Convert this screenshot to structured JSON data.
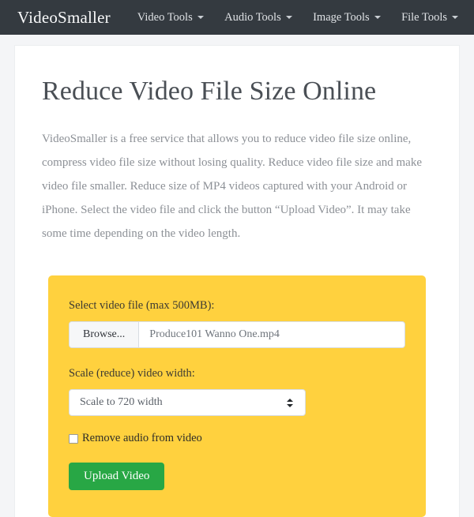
{
  "navbar": {
    "brand": "VideoSmaller",
    "items": [
      {
        "label": "Video Tools",
        "icon": "chevron-down-icon"
      },
      {
        "label": "Audio Tools",
        "icon": "chevron-down-icon"
      },
      {
        "label": "Image Tools",
        "icon": "chevron-down-icon"
      },
      {
        "label": "File Tools",
        "icon": "chevron-down-icon"
      }
    ],
    "background_color": "#343a40",
    "text_color": "#dfe2e5"
  },
  "main": {
    "title": "Reduce Video File Size Online",
    "intro": "VideoSmaller is a free service that allows you to reduce video file size online, compress video file size without losing quality. Reduce video file size and make video file smaller. Reduce size of MP4 videos captured with your Android or iPhone. Select the video file and click the button “Upload Video”. It may take some time depending on the video length."
  },
  "form": {
    "panel_color": "#ffd13e",
    "file_label": "Select video file (max 500MB):",
    "browse_button": "Browse...",
    "file_name": "Produce101 Wanno One.mp4",
    "scale_label": "Scale (reduce) video width:",
    "scale_selected": "Scale to 720 width",
    "scale_options": [
      "Scale to 720 width"
    ],
    "remove_audio_label": "Remove audio from video",
    "remove_audio_checked": false,
    "submit_label": "Upload Video",
    "submit_color": "#28a745"
  }
}
